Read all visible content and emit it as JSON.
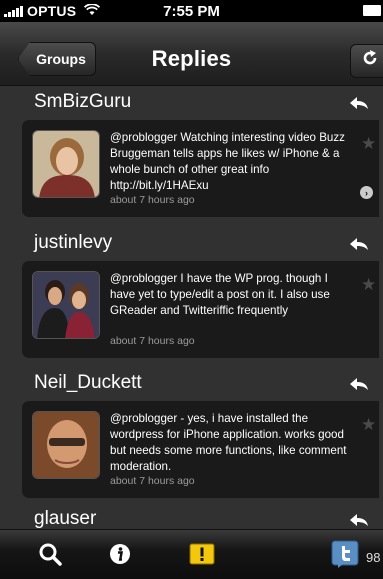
{
  "status": {
    "carrier": "OPTUS",
    "time": "7:55 PM"
  },
  "nav": {
    "back_label": "Groups",
    "title": "Replies"
  },
  "tweets": [
    {
      "username": "SmBizGuru",
      "text": "@problogger Watching interesting video Buzz Bruggeman tells apps he likes w/ iPhone & a whole bunch of other great info http://bit.ly/1HAExu",
      "time": "about 7 hours ago"
    },
    {
      "username": "justinlevy",
      "text": "@problogger I have the WP prog. though I have yet to type/edit a post on it. I also use GReader and Twitteriffic frequently",
      "time": "about 7 hours ago"
    },
    {
      "username": "Neil_Duckett",
      "text": "@problogger - yes, i have installed the wordpress for iPhone application. works good but needs some more functions, like comment moderation.",
      "time": "about 7 hours ago"
    },
    {
      "username": "glauser"
    }
  ],
  "tabbar": {
    "count": "98"
  },
  "icons": {
    "reply": "reply-arrow-icon",
    "star": "star-icon",
    "refresh": "refresh-icon",
    "search": "search-icon",
    "info": "info-icon",
    "alert": "alert-icon",
    "twitter": "twitter-icon"
  },
  "colors": {
    "alert_yellow": "#f2c70d",
    "twitter_blue": "#5a8fc4"
  }
}
